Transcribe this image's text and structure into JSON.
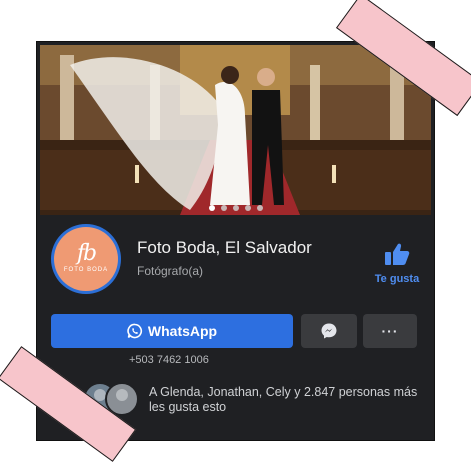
{
  "page": {
    "name": "Foto Boda, El Salvador",
    "category": "Fotógrafo(a)"
  },
  "avatar_logo": {
    "script": "fb",
    "word": "FOTO BODA"
  },
  "like": {
    "label": "Te gusta"
  },
  "actions": {
    "whatsapp_label": "WhatsApp",
    "more_label": "···"
  },
  "phone": "+503 7462 1006",
  "friends": {
    "text": "A Glenda, Jonathan, Cely y 2.847 personas más les gusta esto"
  },
  "carousel": {
    "pages": 5,
    "active": 1
  },
  "colors": {
    "card_bg": "#1f2023",
    "primary": "#2d6fe0",
    "like_blue": "#4f8df0",
    "tape_pink": "#f7c5cb"
  },
  "icons": [
    "whatsapp-icon",
    "messenger-icon",
    "thumbs-up-icon",
    "more-dots-icon"
  ]
}
